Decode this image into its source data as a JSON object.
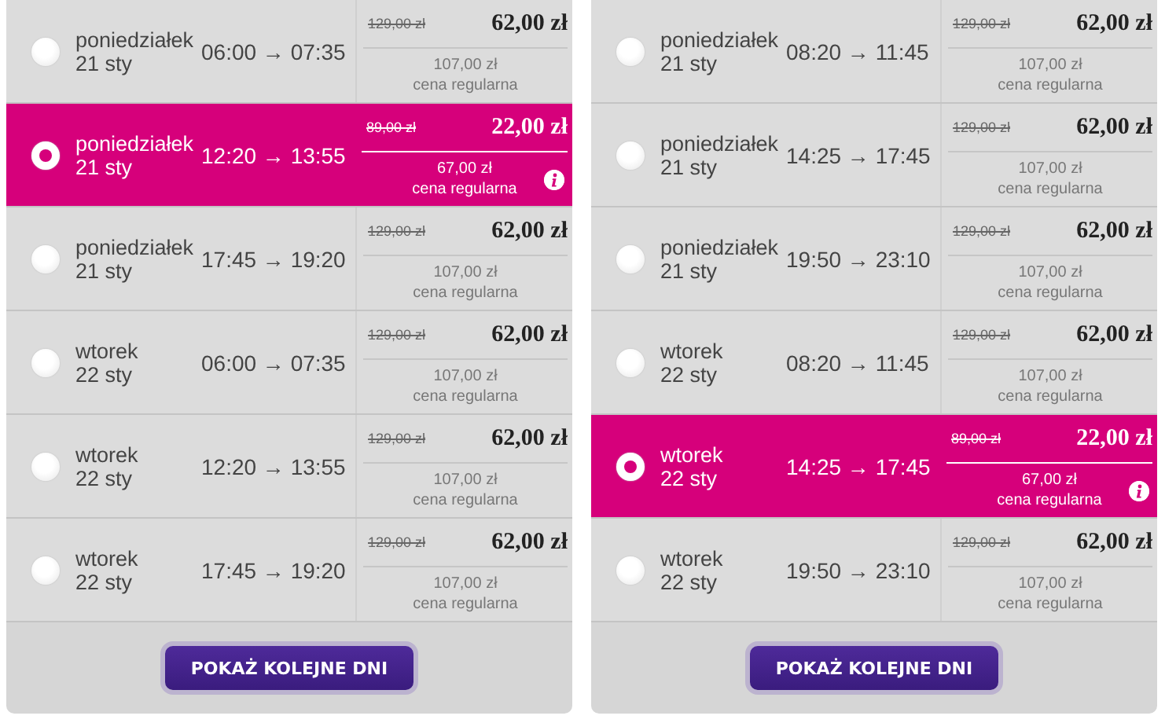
{
  "panels": [
    {
      "rows": [
        {
          "selected": false,
          "day": "poniedziałek",
          "date": "21 sty",
          "times": "06:00 → 07:35",
          "old_price": "129,00 zł",
          "price": "62,00 zł",
          "regular_price": "107,00 zł",
          "regular_label": "cena regularna"
        },
        {
          "selected": true,
          "day": "poniedziałek",
          "date": "21 sty",
          "times": "12:20 → 13:55",
          "old_price": "89,00 zł",
          "price": "22,00 zł",
          "regular_price": "67,00 zł",
          "regular_label": "cena regularna"
        },
        {
          "selected": false,
          "day": "poniedziałek",
          "date": "21 sty",
          "times": "17:45 → 19:20",
          "old_price": "129,00 zł",
          "price": "62,00 zł",
          "regular_price": "107,00 zł",
          "regular_label": "cena regularna"
        },
        {
          "selected": false,
          "day": "wtorek",
          "date": "22 sty",
          "times": "06:00 → 07:35",
          "old_price": "129,00 zł",
          "price": "62,00 zł",
          "regular_price": "107,00 zł",
          "regular_label": "cena regularna"
        },
        {
          "selected": false,
          "day": "wtorek",
          "date": "22 sty",
          "times": "12:20 → 13:55",
          "old_price": "129,00 zł",
          "price": "62,00 zł",
          "regular_price": "107,00 zł",
          "regular_label": "cena regularna"
        },
        {
          "selected": false,
          "day": "wtorek",
          "date": "22 sty",
          "times": "17:45 → 19:20",
          "old_price": "129,00 zł",
          "price": "62,00 zł",
          "regular_price": "107,00 zł",
          "regular_label": "cena regularna"
        }
      ],
      "button": "POKAŻ KOLEJNE DNI"
    },
    {
      "rows": [
        {
          "selected": false,
          "day": "poniedziałek",
          "date": "21 sty",
          "times": "08:20 → 11:45",
          "old_price": "129,00 zł",
          "price": "62,00 zł",
          "regular_price": "107,00 zł",
          "regular_label": "cena regularna"
        },
        {
          "selected": false,
          "day": "poniedziałek",
          "date": "21 sty",
          "times": "14:25 → 17:45",
          "old_price": "129,00 zł",
          "price": "62,00 zł",
          "regular_price": "107,00 zł",
          "regular_label": "cena regularna"
        },
        {
          "selected": false,
          "day": "poniedziałek",
          "date": "21 sty",
          "times": "19:50 → 23:10",
          "old_price": "129,00 zł",
          "price": "62,00 zł",
          "regular_price": "107,00 zł",
          "regular_label": "cena regularna"
        },
        {
          "selected": false,
          "day": "wtorek",
          "date": "22 sty",
          "times": "08:20 → 11:45",
          "old_price": "129,00 zł",
          "price": "62,00 zł",
          "regular_price": "107,00 zł",
          "regular_label": "cena regularna"
        },
        {
          "selected": true,
          "day": "wtorek",
          "date": "22 sty",
          "times": "14:25 → 17:45",
          "old_price": "89,00 zł",
          "price": "22,00 zł",
          "regular_price": "67,00 zł",
          "regular_label": "cena regularna"
        },
        {
          "selected": false,
          "day": "wtorek",
          "date": "22 sty",
          "times": "19:50 → 23:10",
          "old_price": "129,00 zł",
          "price": "62,00 zł",
          "regular_price": "107,00 zł",
          "regular_label": "cena regularna"
        }
      ],
      "button": "POKAŻ KOLEJNE DNI"
    }
  ]
}
